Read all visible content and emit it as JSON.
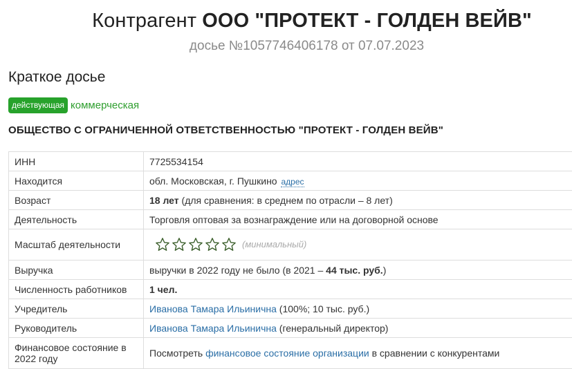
{
  "header": {
    "title_prefix": "Контрагент",
    "title_name": "ООО \"ПРОТЕКТ - ГОЛДЕН ВЕЙВ\"",
    "subtitle": "досье №1057746406178 от 07.07.2023"
  },
  "summary_heading": "Краткое досье",
  "status": {
    "badge": "действующая",
    "type": "коммерческая"
  },
  "full_name": "ОБЩЕСТВО С ОГРАНИЧЕННОЙ ОТВЕТСТВЕННОСТЬЮ \"ПРОТЕКТ - ГОЛДЕН ВЕЙВ\"",
  "rows": {
    "inn": {
      "label": "ИНН",
      "value": "7725534154"
    },
    "location": {
      "label": "Находится",
      "value": "обл. Московская, г. Пушкино",
      "link": "адрес"
    },
    "age": {
      "label": "Возраст",
      "value_bold": "18 лет",
      "value_rest": " (для сравнения: в среднем по отрасли – 8 лет)"
    },
    "activity": {
      "label": "Деятельность",
      "value": "Торговля оптовая за вознаграждение или на договорной основе"
    },
    "scale": {
      "label": "Масштаб деятельности",
      "stars_filled": 0,
      "stars_total": 5,
      "note": "(минимальный)"
    },
    "revenue": {
      "label": "Выручка",
      "value_pre": "выручки в 2022 году не было (в 2021 – ",
      "value_bold": "44 тыс. руб.",
      "value_post": ")"
    },
    "employees": {
      "label": "Численность работников",
      "value_bold": "1 чел."
    },
    "founder": {
      "label": "Учредитель",
      "link": "Иванова Тамара Ильинична",
      "value_rest": " (100%; 10 тыс. руб.)"
    },
    "director": {
      "label": "Руководитель",
      "link": "Иванова Тамара Ильинична",
      "value_rest": " (генеральный директор)"
    },
    "finance": {
      "label": "Финансовое состояние в 2022 году",
      "value_pre": "Посмотреть ",
      "link": "финансовое состояние организации",
      "value_post": " в сравнении с конкурентами"
    }
  },
  "colors": {
    "badge": "#27a22b",
    "link": "#2a6ea6",
    "star": "#3a5e2a"
  }
}
